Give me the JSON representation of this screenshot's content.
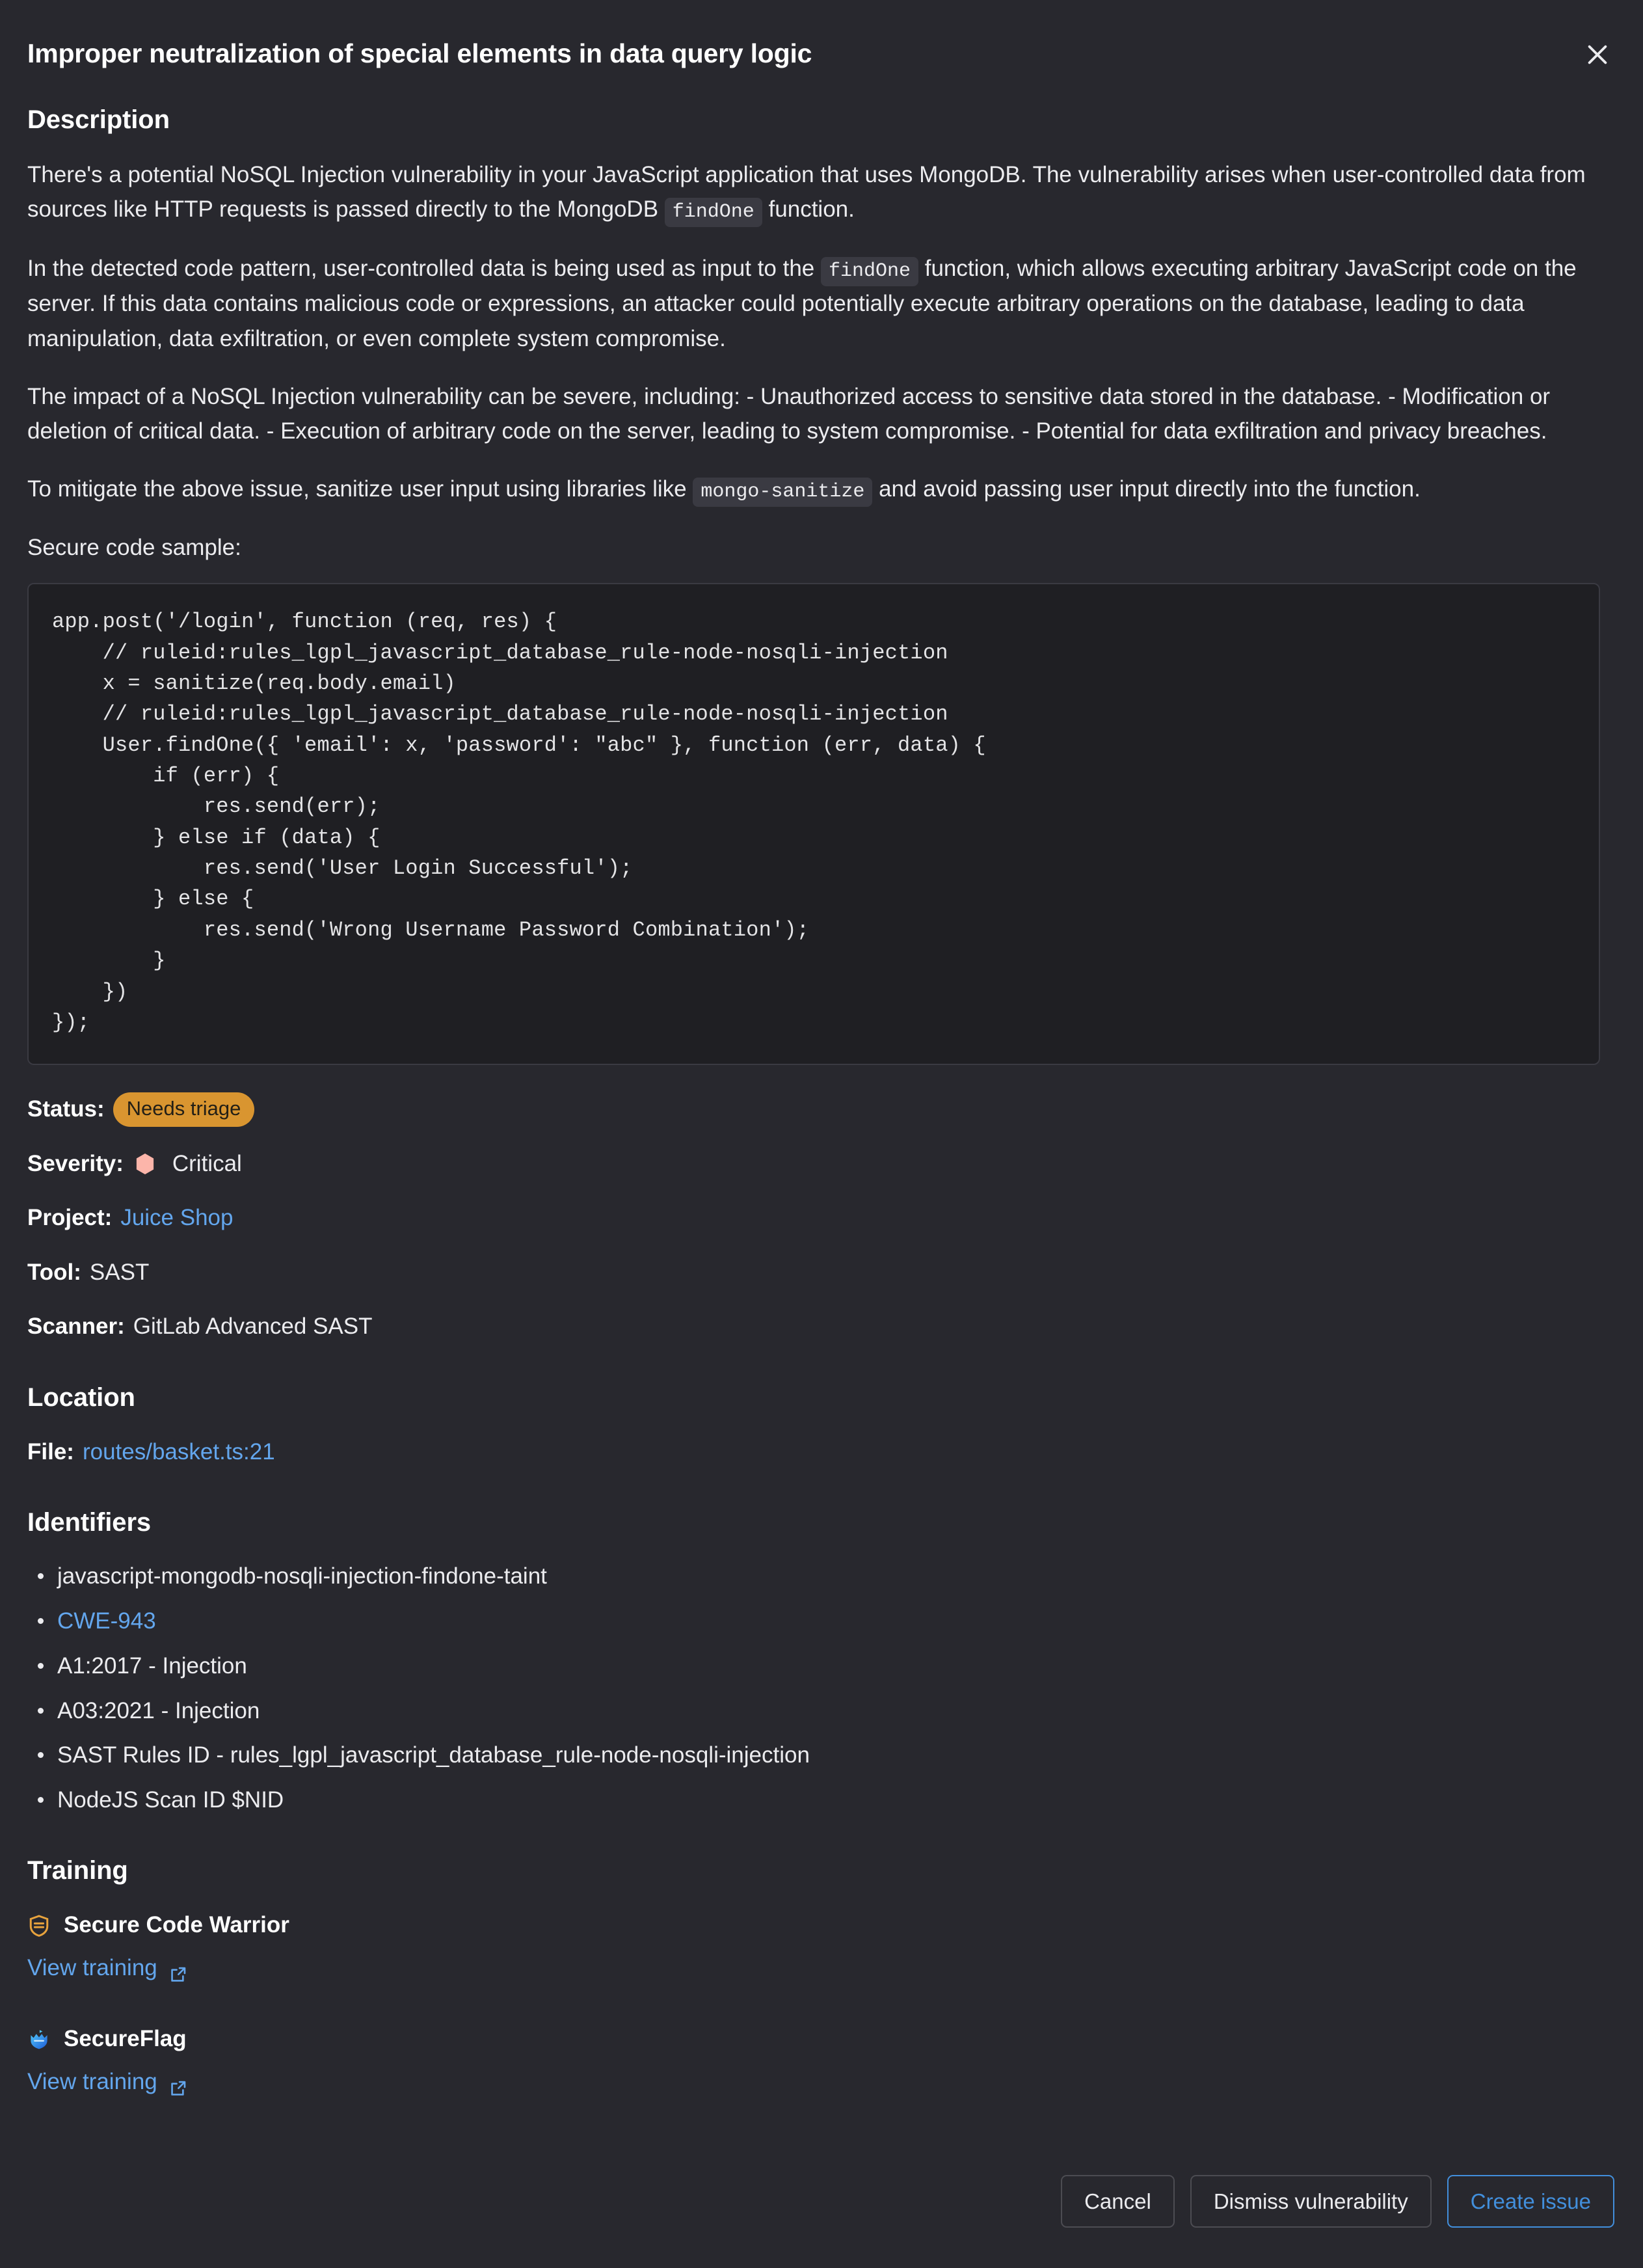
{
  "drawer": {
    "title": "Improper neutralization of special elements in data query logic",
    "close_icon": "close-icon"
  },
  "description": {
    "heading": "Description",
    "p1_a": "There's a potential NoSQL Injection vulnerability in your JavaScript application that uses MongoDB. The vulnerability arises when user-controlled data from sources like HTTP requests is passed directly to the MongoDB ",
    "p1_code": "findOne",
    "p1_b": " function.",
    "p2_a": "In the detected code pattern, user-controlled data is being used as input to the ",
    "p2_code": "findOne",
    "p2_b": " function, which allows executing arbitrary JavaScript code on the server. If this data contains malicious code or expressions, an attacker could potentially execute arbitrary operations on the database, leading to data manipulation, data exfiltration, or even complete system compromise.",
    "p3": "The impact of a NoSQL Injection vulnerability can be severe, including: - Unauthorized access to sensitive data stored in the database. - Modification or deletion of critical data. - Execution of arbitrary code on the server, leading to system compromise. - Potential for data exfiltration and privacy breaches.",
    "p4_a": "To mitigate the above issue, sanitize user input using libraries like ",
    "p4_code": "mongo-sanitize",
    "p4_b": " and avoid passing user input directly into the function.",
    "sample_label": "Secure code sample:",
    "code_sample": "app.post('/login', function (req, res) {\n    // ruleid:rules_lgpl_javascript_database_rule-node-nosqli-injection\n    x = sanitize(req.body.email)\n    // ruleid:rules_lgpl_javascript_database_rule-node-nosqli-injection\n    User.findOne({ 'email': x, 'password': \"abc\" }, function (err, data) {\n        if (err) {\n            res.send(err);\n        } else if (data) {\n            res.send('User Login Successful');\n        } else {\n            res.send('Wrong Username Password Combination');\n        }\n    })\n});"
  },
  "meta": {
    "status_label": "Status:",
    "status_value": "Needs triage",
    "status_color": "#d99530",
    "severity_label": "Severity:",
    "severity_value": "Critical",
    "severity_color": "#fcb5aa",
    "project_label": "Project:",
    "project_value": "Juice Shop",
    "tool_label": "Tool:",
    "tool_value": "SAST",
    "scanner_label": "Scanner:",
    "scanner_value": "GitLab Advanced SAST"
  },
  "location": {
    "heading": "Location",
    "file_label": "File:",
    "file_value": "routes/basket.ts:21"
  },
  "identifiers": {
    "heading": "Identifiers",
    "items": [
      {
        "text": "javascript-mongodb-nosqli-injection-findone-taint",
        "link": false
      },
      {
        "text": "CWE-943",
        "link": true
      },
      {
        "text": "A1:2017 - Injection",
        "link": false
      },
      {
        "text": "A03:2021 - Injection",
        "link": false
      },
      {
        "text": "SAST Rules ID - rules_lgpl_javascript_database_rule-node-nosqli-injection",
        "link": false
      },
      {
        "text": "NodeJS Scan ID $NID",
        "link": false
      }
    ]
  },
  "training": {
    "heading": "Training",
    "providers": [
      {
        "name": "Secure Code Warrior",
        "icon": "secure-code-warrior-shield-icon",
        "link_label": "View training"
      },
      {
        "name": "SecureFlag",
        "icon": "secureflag-shield-icon",
        "link_label": "View training"
      }
    ]
  },
  "footer": {
    "cancel_label": "Cancel",
    "dismiss_label": "Dismiss vulnerability",
    "create_issue_label": "Create issue",
    "primary_color": "#428fdc"
  }
}
